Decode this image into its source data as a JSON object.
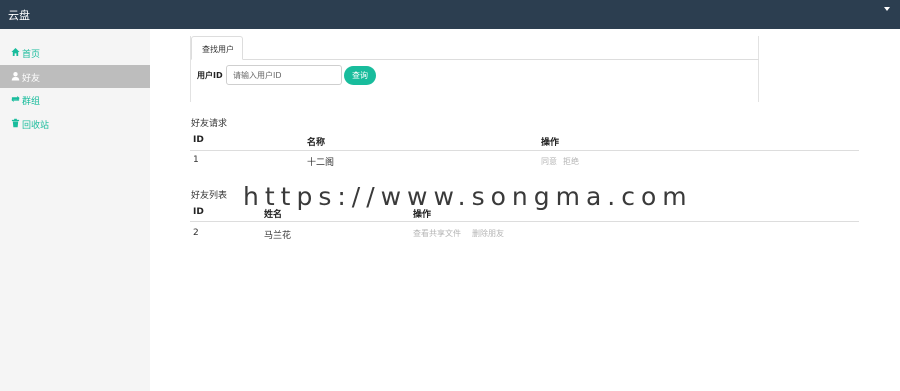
{
  "navbar": {
    "brand": "云盘",
    "dropdown_icon": "caret-down-icon"
  },
  "sidebar": {
    "items": [
      {
        "label": "首页",
        "icon": "home-icon",
        "active": false
      },
      {
        "label": "好友",
        "icon": "user-icon",
        "active": true
      },
      {
        "label": "群组",
        "icon": "retweet-icon",
        "active": false
      },
      {
        "label": "回收站",
        "icon": "trash-icon",
        "active": false
      }
    ]
  },
  "search": {
    "tab_label": "查找用户",
    "field_label": "用户ID",
    "placeholder": "请输入用户ID",
    "button_label": "查询"
  },
  "requests": {
    "title": "好友请求",
    "headers": [
      "ID",
      "名称",
      "操作"
    ],
    "rows": [
      {
        "id": "1",
        "name": "十二阁",
        "actions": [
          "同意",
          "拒绝"
        ]
      }
    ]
  },
  "friends": {
    "title": "好友列表",
    "headers": [
      "ID",
      "姓名",
      "操作"
    ],
    "rows": [
      {
        "id": "2",
        "name": "马兰花",
        "actions": [
          "查看共享文件",
          "删除朋友"
        ]
      }
    ]
  },
  "watermark": "https://www.songma.com",
  "colors": {
    "navbar": "#2c3e50",
    "accent": "#18bc9c",
    "sidebar": "#f5f5f5",
    "sidebar_active": "#bdbdbd"
  }
}
